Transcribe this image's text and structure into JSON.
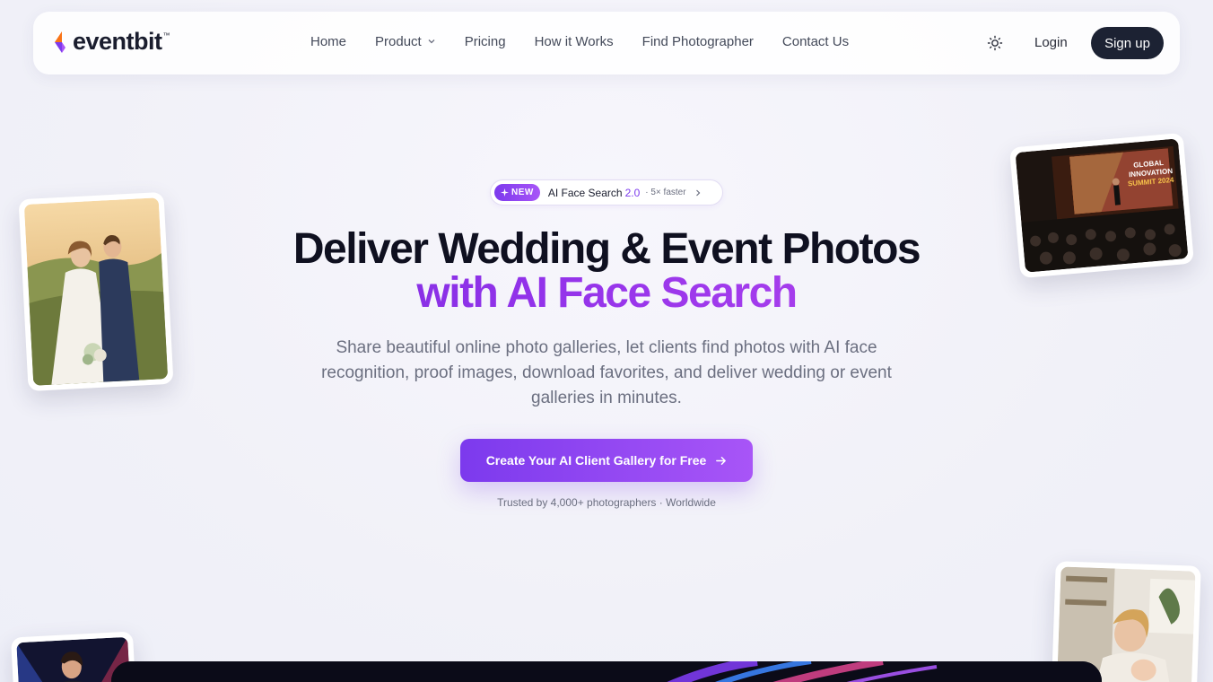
{
  "nav": {
    "logo_text": "eventbit",
    "logo_tm": "™",
    "links": [
      {
        "label": "Home"
      },
      {
        "label": "Product"
      },
      {
        "label": "Pricing"
      },
      {
        "label": "How it Works"
      },
      {
        "label": "Find Photographer"
      },
      {
        "label": "Contact Us"
      }
    ],
    "login": "Login",
    "signup": "Sign up"
  },
  "badge": {
    "new": "NEW",
    "title": "AI Face Search",
    "version": "2.0",
    "sub": "· 5× faster"
  },
  "hero": {
    "line1": "Deliver Wedding & Event Photos",
    "line2": "with AI Face Search",
    "subtitle": "Share beautiful online photo galleries, let clients find photos with AI face recognition, proof images, download favorites, and deliver wedding or event galleries in minutes.",
    "cta": "Create Your AI Client Gallery for Free",
    "trust": "Trusted by 4,000+ photographers · Worldwide"
  },
  "photos": {
    "conference_sign_1": "GLOBAL",
    "conference_sign_2": "INNOVATION",
    "conference_sign_3": "SUMMIT 2024"
  },
  "colors": {
    "accent": "#7c3aed",
    "accent_light": "#a855f7",
    "dark": "#1c2233"
  }
}
